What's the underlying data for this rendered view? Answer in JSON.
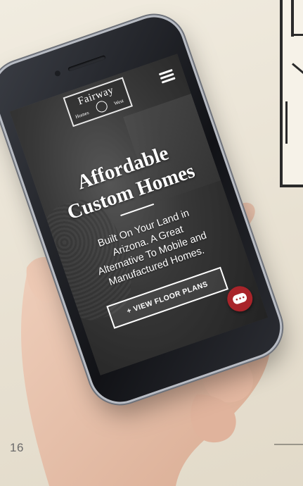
{
  "page": {
    "page_number": "16"
  },
  "phone_screen": {
    "logo": {
      "name": "Fairway",
      "left_word": "Homes",
      "right_word": "West"
    },
    "menu_icon": "hamburger-menu-icon",
    "headline_line1": "Affordable",
    "headline_line2": "Custom Homes",
    "subtext_line1": "Built On Your Land in",
    "subtext_line2": "Arizona. A Great",
    "subtext_line3": "Alternative To Mobile and",
    "subtext_line4": "Manufactured Homes.",
    "cta_label": "+ VIEW FLOOR PLANS",
    "chat_icon": "chat-bubble-icon",
    "colors": {
      "chat_button": "#a8242a",
      "text": "#ffffff"
    }
  }
}
